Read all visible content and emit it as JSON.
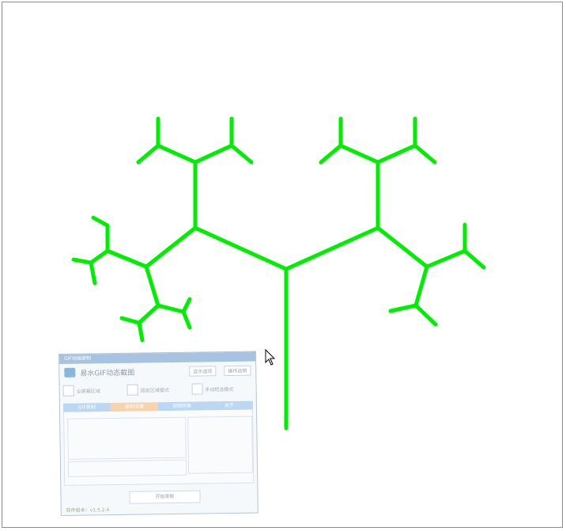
{
  "canvas": {
    "background": "#ffffff",
    "border_color": "#8c8c8c",
    "tree": {
      "color": "#00ee00",
      "description_icon": "fractal-tree",
      "branch_count": 31
    }
  },
  "cursor": {
    "icon": "arrow-cursor-icon"
  },
  "recorder": {
    "title": "GIF动画录制",
    "app_title": "易水GIF动态截图",
    "header_buttons": [
      "显示选项",
      "操作说明"
    ],
    "modes": [
      "全屏幕区域",
      "固定区域模式",
      "手动框选模式"
    ],
    "tabs": [
      "GIF录制",
      "录制设置",
      "视频转换",
      "关于"
    ],
    "active_tab": 1,
    "start_button": "开始录制",
    "version": "软件版本：v1.5.2.4",
    "accent": "#6aa3d8",
    "tab_active_color": "#f7c79a"
  }
}
